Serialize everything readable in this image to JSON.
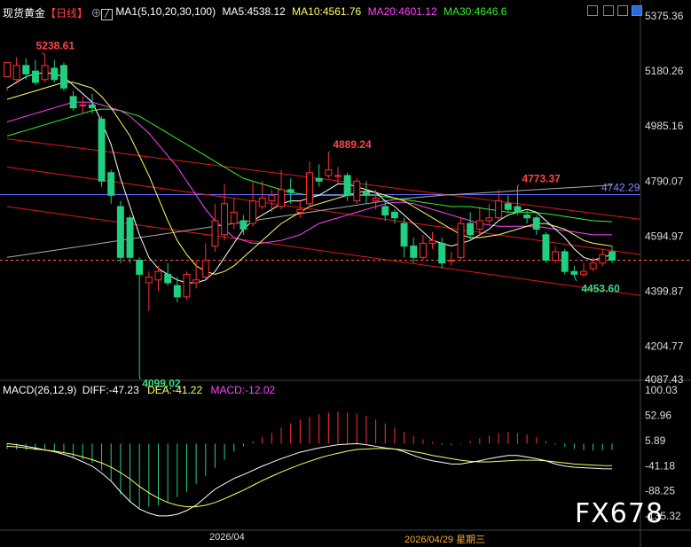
{
  "header": {
    "symbol": "现货黄金",
    "period": "【日线】",
    "ma_label": "MA1(5,10,20,30,100)",
    "ma5": "MA5:4538.12",
    "ma10": "MA10:4561.76",
    "ma20": "MA20:4601.12",
    "ma30": "MA30:4646.6"
  },
  "macd_header": {
    "label": "MACD(26,12,9)",
    "diff": "DIFF:-47.23",
    "dea": "DEA:-41.22",
    "macd": "MACD:-12.02"
  },
  "watermark": "FX678",
  "x_labels": [
    "2026/04",
    "2026/04/29 星期三"
  ],
  "annotations": {
    "high": "5238.61",
    "low": "4099.02",
    "peak2": "4889.24",
    "peak3": "4773.37",
    "last_low": "4453.60",
    "hline": "4742.29"
  },
  "colors": {
    "up": "#ff3030",
    "down": "#20d080",
    "ma5": "#ffffff",
    "ma10": "#ffff66",
    "ma20": "#ff44ff",
    "ma30": "#33ee33",
    "ma100": "#aaaaaa",
    "channel": "#e01818",
    "hline": "#6666ff"
  },
  "chart_data": [
    {
      "type": "candlestick",
      "title": "现货黄金【日线】",
      "y_ticks": [
        "5375.36",
        "5180.26",
        "4985.16",
        "4790.07",
        "4594.97",
        "4399.87",
        "4204.77",
        "4087.43"
      ],
      "ylim": [
        4087.43,
        5375.36
      ],
      "candles": [
        [
          5160,
          5210,
          5120,
          5110
        ],
        [
          5150,
          5200,
          5230,
          5140
        ],
        [
          5200,
          5170,
          5225,
          5150
        ],
        [
          5180,
          5140,
          5220,
          5130
        ],
        [
          5150,
          5200,
          5238.61,
          5140
        ],
        [
          5190,
          5150,
          5220,
          5140
        ],
        [
          5200,
          5120,
          5210,
          5110
        ],
        [
          5090,
          5050,
          5110,
          5040
        ],
        [
          5060,
          5060,
          5090,
          5030
        ],
        [
          5060,
          5050,
          5100,
          5030
        ],
        [
          5010,
          4790,
          5020,
          4770
        ],
        [
          4820,
          4740,
          4830,
          4710
        ],
        [
          4700,
          4520,
          4720,
          4500
        ],
        [
          4660,
          4520,
          4670,
          4500
        ],
        [
          4510,
          4460,
          4520,
          4099.02
        ],
        [
          4430,
          4450,
          4470,
          4330
        ],
        [
          4440,
          4470,
          4490,
          4400
        ],
        [
          4460,
          4430,
          4500,
          4420
        ],
        [
          4420,
          4380,
          4450,
          4360
        ],
        [
          4380,
          4460,
          4470,
          4370
        ],
        [
          4430,
          4440,
          4510,
          4410
        ],
        [
          4450,
          4510,
          4570,
          4440
        ],
        [
          4560,
          4650,
          4710,
          4540
        ],
        [
          4600,
          4710,
          4780,
          4580
        ],
        [
          4640,
          4680,
          4730,
          4620
        ],
        [
          4650,
          4620,
          4670,
          4600
        ],
        [
          4640,
          4720,
          4790,
          4630
        ],
        [
          4700,
          4730,
          4790,
          4690
        ],
        [
          4720,
          4740,
          4760,
          4680
        ],
        [
          4700,
          4760,
          4830,
          4690
        ],
        [
          4760,
          4750,
          4800,
          4710
        ],
        [
          4680,
          4690,
          4720,
          4660
        ],
        [
          4710,
          4820,
          4860,
          4700
        ],
        [
          4800,
          4790,
          4850,
          4770
        ],
        [
          4810,
          4830,
          4889.24,
          4800
        ],
        [
          4810,
          4810,
          4840,
          4780
        ],
        [
          4810,
          4740,
          4820,
          4720
        ],
        [
          4720,
          4790,
          4800,
          4710
        ],
        [
          4750,
          4740,
          4790,
          4710
        ],
        [
          4720,
          4730,
          4760,
          4690
        ],
        [
          4700,
          4670,
          4720,
          4650
        ],
        [
          4680,
          4660,
          4690,
          4640
        ],
        [
          4640,
          4560,
          4660,
          4520
        ],
        [
          4560,
          4520,
          4590,
          4500
        ],
        [
          4520,
          4570,
          4600,
          4510
        ],
        [
          4570,
          4580,
          4610,
          4550
        ],
        [
          4570,
          4500,
          4590,
          4480
        ],
        [
          4510,
          4510,
          4540,
          4490
        ],
        [
          4520,
          4640,
          4660,
          4510
        ],
        [
          4640,
          4600,
          4680,
          4580
        ],
        [
          4620,
          4650,
          4700,
          4600
        ],
        [
          4650,
          4660,
          4710,
          4640
        ],
        [
          4660,
          4720,
          4760,
          4650
        ],
        [
          4710,
          4690,
          4740,
          4680
        ],
        [
          4700,
          4680,
          4773.37,
          4670
        ],
        [
          4670,
          4660,
          4690,
          4640
        ],
        [
          4660,
          4620,
          4670,
          4600
        ],
        [
          4600,
          4510,
          4610,
          4500
        ],
        [
          4510,
          4540,
          4560,
          4500
        ],
        [
          4540,
          4470,
          4550,
          4460
        ],
        [
          4470,
          4460,
          4490,
          4453.6
        ],
        [
          4460,
          4470,
          4500,
          4450
        ],
        [
          4480,
          4500,
          4520,
          4470
        ],
        [
          4500,
          4530,
          4550,
          4490
        ],
        [
          4540,
          4510,
          4560,
          4500
        ]
      ],
      "ma5": [
        5120,
        5140,
        5160,
        5170,
        5175,
        5170,
        5160,
        5130,
        5100,
        5070,
        5000,
        4920,
        4800,
        4700,
        4600,
        4520,
        4480,
        4460,
        4440,
        4430,
        4430,
        4440,
        4470,
        4520,
        4570,
        4620,
        4650,
        4670,
        4690,
        4710,
        4720,
        4720,
        4730,
        4740,
        4760,
        4780,
        4780,
        4770,
        4760,
        4750,
        4720,
        4700,
        4670,
        4640,
        4610,
        4580,
        4570,
        4560,
        4570,
        4580,
        4600,
        4620,
        4650,
        4670,
        4680,
        4690,
        4680,
        4650,
        4620,
        4590,
        4550,
        4520,
        4510,
        4520,
        4530
      ],
      "ma10": [
        5080,
        5090,
        5100,
        5110,
        5120,
        5130,
        5140,
        5140,
        5130,
        5120,
        5090,
        5050,
        5000,
        4950,
        4880,
        4810,
        4730,
        4650,
        4580,
        4530,
        4490,
        4470,
        4460,
        4470,
        4490,
        4520,
        4550,
        4580,
        4610,
        4640,
        4660,
        4680,
        4700,
        4710,
        4720,
        4730,
        4740,
        4750,
        4755,
        4750,
        4740,
        4730,
        4720,
        4700,
        4680,
        4660,
        4640,
        4620,
        4600,
        4590,
        4590,
        4595,
        4600,
        4610,
        4620,
        4630,
        4640,
        4640,
        4630,
        4620,
        4600,
        4580,
        4570,
        4565,
        4560
      ],
      "ma20": [
        5000,
        5010,
        5020,
        5030,
        5040,
        5050,
        5060,
        5070,
        5070,
        5070,
        5060,
        5050,
        5040,
        5020,
        4990,
        4960,
        4920,
        4880,
        4840,
        4790,
        4740,
        4690,
        4650,
        4620,
        4590,
        4580,
        4570,
        4570,
        4575,
        4580,
        4590,
        4600,
        4620,
        4640,
        4650,
        4660,
        4670,
        4680,
        4690,
        4700,
        4710,
        4715,
        4715,
        4710,
        4700,
        4690,
        4680,
        4670,
        4660,
        4650,
        4640,
        4635,
        4630,
        4630,
        4630,
        4630,
        4630,
        4625,
        4620,
        4615,
        4610,
        4605,
        4600,
        4600,
        4600
      ],
      "ma30": [
        4950,
        4960,
        4970,
        4980,
        4990,
        5000,
        5010,
        5020,
        5030,
        5040,
        5045,
        5045,
        5040,
        5030,
        5020,
        5000,
        4980,
        4960,
        4940,
        4920,
        4900,
        4880,
        4860,
        4840,
        4820,
        4800,
        4790,
        4780,
        4770,
        4760,
        4750,
        4745,
        4740,
        4740,
        4740,
        4740,
        4740,
        4740,
        4740,
        4740,
        4735,
        4730,
        4725,
        4720,
        4715,
        4710,
        4705,
        4700,
        4700,
        4700,
        4695,
        4690,
        4685,
        4680,
        4680,
        4680,
        4678,
        4675,
        4670,
        4665,
        4660,
        4655,
        4650,
        4648,
        4646
      ],
      "ma100": [
        4520,
        4525,
        4530,
        4535,
        4540,
        4545,
        4550,
        4555,
        4560,
        4565,
        4570,
        4575,
        4580,
        4585,
        4590,
        4595,
        4600,
        4605,
        4610,
        4615,
        4620,
        4625,
        4630,
        4635,
        4640,
        4645,
        4650,
        4655,
        4660,
        4665,
        4670,
        4675,
        4680,
        4685,
        4690,
        4695,
        4700,
        4705,
        4710,
        4715,
        4720,
        4725,
        4728,
        4731,
        4734,
        4737,
        4740,
        4742,
        4744,
        4746,
        4748,
        4750,
        4752,
        4754,
        4756,
        4758,
        4760,
        4762,
        4764,
        4766,
        4768,
        4770,
        4772,
        4774,
        4776
      ]
    },
    {
      "type": "bar",
      "title": "MACD(26,12,9)",
      "y_ticks": [
        "100.03",
        "52.96",
        "5.89",
        "-41.18",
        "-88.25",
        "-135.32"
      ],
      "ylim": [
        -160,
        115
      ],
      "hist": [
        -10,
        -11,
        -12,
        -13,
        -12,
        -15,
        -18,
        -25,
        -30,
        -36,
        -50,
        -70,
        -95,
        -110,
        -120,
        -118,
        -115,
        -110,
        -100,
        -90,
        -75,
        -60,
        -45,
        -30,
        -15,
        -5,
        5,
        12,
        20,
        30,
        38,
        45,
        50,
        55,
        58,
        60,
        58,
        56,
        52,
        45,
        38,
        30,
        22,
        15,
        8,
        3,
        -2,
        -3,
        -1,
        5,
        10,
        15,
        20,
        22,
        20,
        17,
        12,
        5,
        -2,
        -6,
        -10,
        -12,
        -13,
        -12,
        -12
      ],
      "diff": [
        0,
        -2,
        -5,
        -8,
        -12,
        -15,
        -20,
        -26,
        -34,
        -42,
        -55,
        -70,
        -90,
        -108,
        -122,
        -130,
        -135,
        -135,
        -132,
        -125,
        -115,
        -100,
        -85,
        -75,
        -65,
        -58,
        -50,
        -42,
        -35,
        -28,
        -22,
        -16,
        -12,
        -8,
        -5,
        -2,
        -1,
        0,
        -2,
        -5,
        -8,
        -10,
        -15,
        -22,
        -28,
        -32,
        -35,
        -38,
        -38,
        -35,
        -32,
        -28,
        -25,
        -22,
        -22,
        -25,
        -28,
        -32,
        -38,
        -42,
        -44,
        -45,
        -46,
        -47,
        -47.23
      ],
      "dea": [
        -5,
        -6,
        -8,
        -10,
        -12,
        -14,
        -17,
        -20,
        -25,
        -30,
        -36,
        -44,
        -54,
        -66,
        -80,
        -92,
        -102,
        -110,
        -115,
        -118,
        -118,
        -115,
        -110,
        -103,
        -95,
        -87,
        -78,
        -69,
        -61,
        -53,
        -46,
        -39,
        -33,
        -27,
        -22,
        -18,
        -14,
        -11,
        -10,
        -9,
        -9,
        -10,
        -12,
        -15,
        -18,
        -22,
        -25,
        -28,
        -31,
        -33,
        -34,
        -34,
        -33,
        -32,
        -31,
        -31,
        -31,
        -32,
        -34,
        -36,
        -38,
        -39,
        -40,
        -41,
        -41.22
      ]
    }
  ]
}
